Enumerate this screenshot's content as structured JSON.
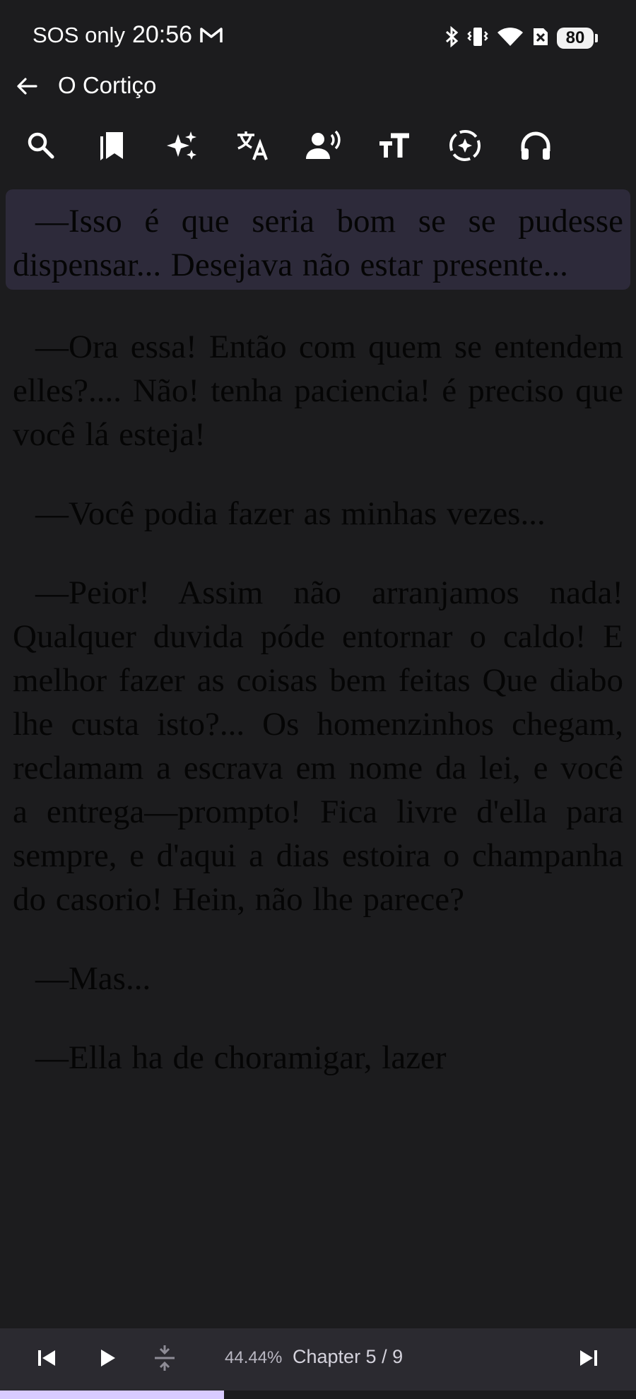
{
  "status_bar": {
    "carrier": "SOS only",
    "time": "20:56",
    "battery": "80",
    "icons": [
      "mail-icon",
      "bluetooth-icon",
      "vibrate-icon",
      "wifi-icon",
      "no-sim-icon",
      "battery-icon"
    ]
  },
  "app_bar": {
    "back_icon": "arrow-back-icon",
    "title": "O Cortiço"
  },
  "toolbar": {
    "items": [
      "search-icon",
      "bookmarks-icon",
      "ai-sparkle-icon",
      "translate-icon",
      "voice-icon",
      "text-size-icon",
      "auto-scroll-icon",
      "headphones-icon"
    ]
  },
  "content": {
    "paragraphs": [
      "—Isso é que seria bom se se pudesse dispensar... Desejava não estar presente...",
      "—Ora essa! Então com quem se entendem elles?.... Não! tenha paciencia! é preciso que você lá esteja!",
      "—Você podia fazer as minhas vezes...",
      "—Peior! Assim não arranjamos nada! Qualquer duvida póde entornar o caldo! E melhor fazer as coisas bem feitas Que diabo lhe custa isto?... Os homenzinhos chegam, reclamam a escrava em nome da lei, e você a entrega—prompto! Fica livre d'ella para sempre, e d'aqui a dias estoira o champanha do casorio! Hein, não lhe parece?",
      "—Mas...",
      "—Ella ha de choramigar, lazer"
    ],
    "highlighted_index": 0,
    "highlight_color": "#2d2a3a"
  },
  "player": {
    "percent": "44.44%",
    "chapter": "Chapter 5 / 9",
    "progress_fraction": 0.3522,
    "accent": "#d9cbff",
    "icons": [
      "skip-previous-icon",
      "play-icon",
      "collapse-icon",
      "skip-next-icon"
    ]
  }
}
